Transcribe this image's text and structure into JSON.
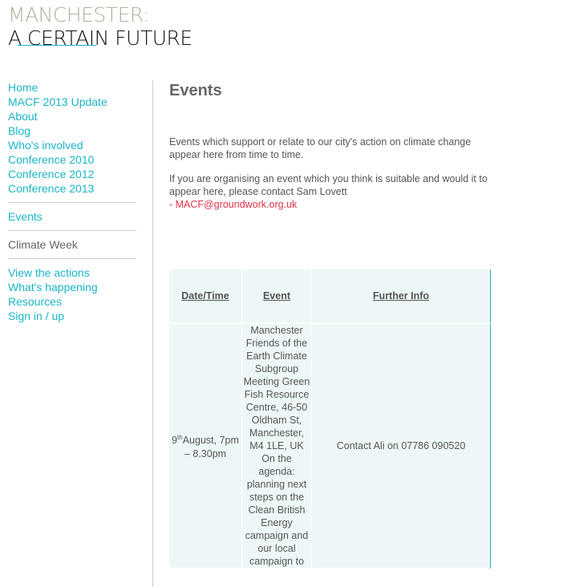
{
  "site": {
    "logo_line1": "MANCHESTER:",
    "logo_line2": "A CERTAIN FUTURE"
  },
  "sidebar": {
    "group1": [
      "Home",
      "MACF 2013 Update",
      "About",
      "Blog",
      "Who's involved",
      "Conference 2010",
      "Conference 2012",
      "Conference 2013"
    ],
    "events": "Events",
    "climate_week": "Climate Week",
    "group2": [
      "View the actions",
      "What's happening",
      "Resources",
      "Sign in / up"
    ]
  },
  "main": {
    "title": "Events",
    "intro1": "Events which support or relate to our city's action on climate change appear here from time to time.",
    "intro2": "If you are organising an event which you think is suitable and would it to appear here, please contact Sam Lovett",
    "intro2_dash": "- ",
    "email": "MACF@groundwork.org.uk"
  },
  "table": {
    "headers": [
      "Date/Time",
      "Event",
      "Further Info"
    ],
    "rows": [
      {
        "date_day": "9",
        "date_sup": "th",
        "date_rest": "August, 7pm – 8.30pm",
        "event": "Manchester Friends of the Earth Climate Subgroup Meeting Green Fish Resource Centre, 46-50 Oldham St, Manchester, M4 1LE, UK On the agenda: planning next steps on the Clean British Energy campaign and our local campaign to",
        "info": "Contact Ali on 07786 090520"
      }
    ]
  }
}
